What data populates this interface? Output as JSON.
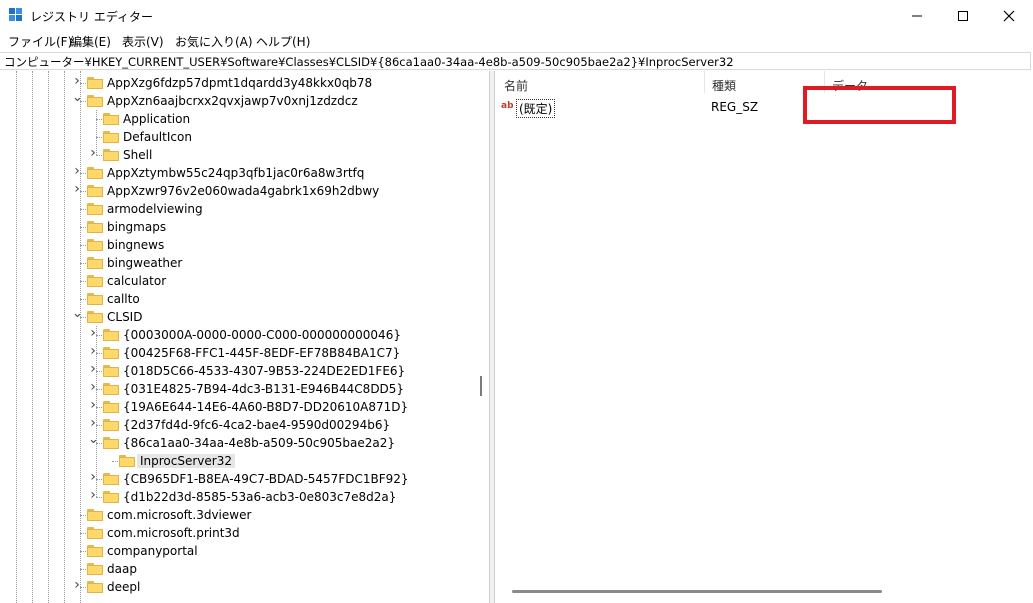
{
  "window": {
    "title": "レジストリ エディター",
    "controls": {
      "minimize": "minimize-icon",
      "maximize": "maximize-icon",
      "close": "close-icon"
    }
  },
  "menu": [
    "ファイル(F)",
    "編集(E)",
    "表示(V)",
    "お気に入り(A)",
    "ヘルプ(H)"
  ],
  "address": "コンピューター¥HKEY_CURRENT_USER¥Software¥Classes¥CLSID¥{86ca1aa0-34aa-4e8b-a509-50c905bae2a2}¥InprocServer32",
  "tree": [
    {
      "label": "AppXzg6fdzp57dpmt1dqardd3y48kkx0qb78",
      "level": 0,
      "expander": "collapsed"
    },
    {
      "label": "AppXzn6aajbcrxx2qvxjawp7v0xnj1zdzdcz",
      "level": 0,
      "expander": "expanded"
    },
    {
      "label": "Application",
      "level": 1,
      "expander": "none"
    },
    {
      "label": "DefaultIcon",
      "level": 1,
      "expander": "none"
    },
    {
      "label": "Shell",
      "level": 1,
      "expander": "collapsed"
    },
    {
      "label": "AppXztymbw55c24qp3qfb1jac0r6a8w3rtfq",
      "level": 0,
      "expander": "collapsed"
    },
    {
      "label": "AppXzwr976v2e060wada4gabrk1x69h2dbwy",
      "level": 0,
      "expander": "collapsed"
    },
    {
      "label": "armodelviewing",
      "level": 0,
      "expander": "none"
    },
    {
      "label": "bingmaps",
      "level": 0,
      "expander": "none"
    },
    {
      "label": "bingnews",
      "level": 0,
      "expander": "none"
    },
    {
      "label": "bingweather",
      "level": 0,
      "expander": "none"
    },
    {
      "label": "calculator",
      "level": 0,
      "expander": "none"
    },
    {
      "label": "callto",
      "level": 0,
      "expander": "none"
    },
    {
      "label": "CLSID",
      "level": 0,
      "expander": "expanded"
    },
    {
      "label": "{0003000A-0000-0000-C000-000000000046}",
      "level": 1,
      "expander": "collapsed"
    },
    {
      "label": "{00425F68-FFC1-445F-8EDF-EF78B84BA1C7}",
      "level": 1,
      "expander": "collapsed"
    },
    {
      "label": "{018D5C66-4533-4307-9B53-224DE2ED1FE6}",
      "level": 1,
      "expander": "collapsed"
    },
    {
      "label": "{031E4825-7B94-4dc3-B131-E946B44C8DD5}",
      "level": 1,
      "expander": "collapsed"
    },
    {
      "label": "{19A6E644-14E6-4A60-B8D7-DD20610A871D}",
      "level": 1,
      "expander": "collapsed"
    },
    {
      "label": "{2d37fd4d-9fc6-4ca2-bae4-9590d00294b6}",
      "level": 1,
      "expander": "collapsed"
    },
    {
      "label": "{86ca1aa0-34aa-4e8b-a509-50c905bae2a2}",
      "level": 1,
      "expander": "expanded"
    },
    {
      "label": "InprocServer32",
      "level": 2,
      "expander": "none",
      "selected": true
    },
    {
      "label": "{CB965DF1-B8EA-49C7-BDAD-5457FDC1BF92}",
      "level": 1,
      "expander": "collapsed"
    },
    {
      "label": "{d1b22d3d-8585-53a6-acb3-0e803c7e8d2a}",
      "level": 1,
      "expander": "collapsed"
    },
    {
      "label": "com.microsoft.3dviewer",
      "level": 0,
      "expander": "none"
    },
    {
      "label": "com.microsoft.print3d",
      "level": 0,
      "expander": "none"
    },
    {
      "label": "companyportal",
      "level": 0,
      "expander": "none"
    },
    {
      "label": "daap",
      "level": 0,
      "expander": "none"
    },
    {
      "label": "deepl",
      "level": 0,
      "expander": "collapsed"
    }
  ],
  "columns": {
    "name": "名前",
    "type": "種類",
    "data": "データ"
  },
  "values": [
    {
      "icon": "ab",
      "name": "(既定)",
      "type": "REG_SZ",
      "data": ""
    }
  ],
  "highlight_color": "#e01b24"
}
